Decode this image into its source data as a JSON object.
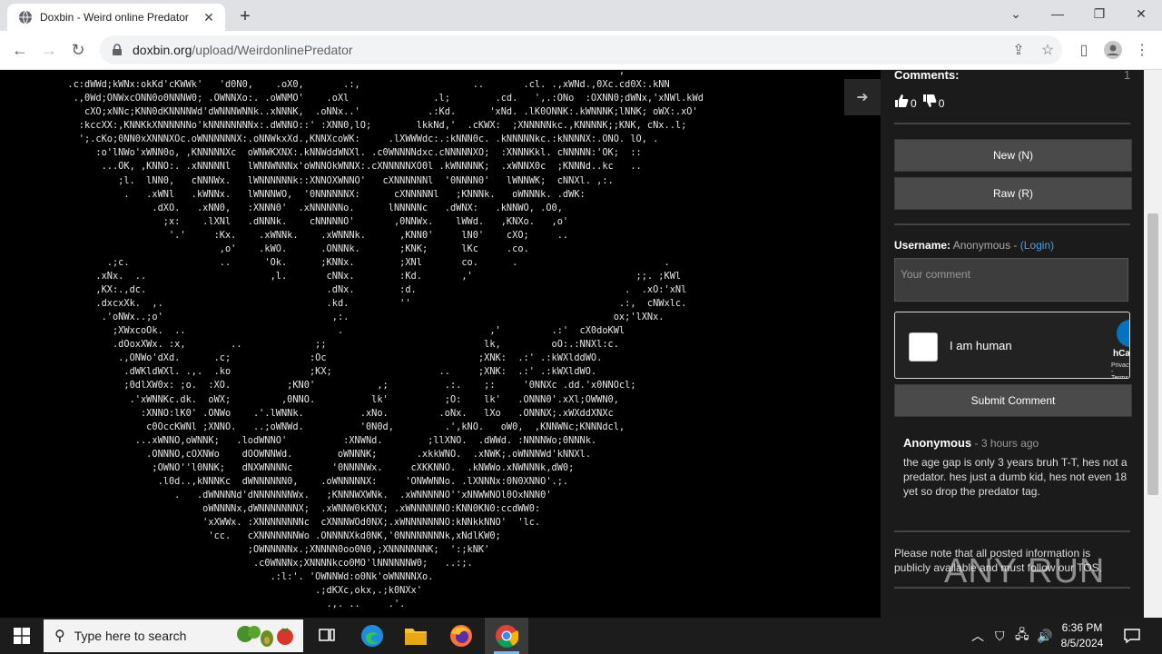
{
  "browser": {
    "tab_title": "Doxbin - Weird online Predator",
    "url_host": "doxbin.org",
    "url_path": "/upload/WeirdonlinePredator"
  },
  "ascii_art": "                                                                                                              ,\n            .c:dWWd;kWNx:okKd'cKWWk'   'd0N0,    .oX0,       .:,                    ..       .cl. .,xWNd.,0Xc.cd0X:.kNN\n             .,0Wd;ONWxcONN0o0NNNW0; .OWNNXo:. .oWNMO'    .oXl               .l;        .cd.   ',.:ONo  :OXNN0;dWNx,'xNWl.kWd\n               cXO;xNNc;KNN0dKNNNNWd'dWNNNWNNk..xNNNK,  .oNNx..'            .:Kd.      'xNd. .lK0ONNK:.kWNNNK;lNNK; oWX:.xO'\n              :kccXX:,KNNKkXNNNNNNo'kNNNNNNNNx:.dWNNO::' :XNN0,lO;        lkkNd,'  .cKWX:  ;XNNNNNkc.,KNNNNK;;KNK, cNx..l;\n              ';.cKo;0NN0xXNNNXOc.oWNNNNNNX:.oNNWkxXd.,KNNXcoWK:     .lXWWWdc:.:kNNN0c. .kNNNNNkc.:kNNNNX:.ONO. lO, .\n                 :o'lNWo'xWNN0o, ,KNNNNNXc  oWNWKXNX:.kNNWddWNXl. .c0WNNNNdxc.cNNNNNXO;  :XNNNKkl. cNNNNN:'OK;  ::\n                  ...OK, ,KNNO:. .xNNNNNl   lWNNWNNNx'oWNNOkWNNX:.cXNNNNNXO0l .kWNNNNK;  .xWNNX0c  ;KNNNd..kc   ..\n                     ;l.  lNN0,   cNNNWx.   lWNNNNNNk::XNNOXWNNO'   cXNNNNNNl  '0NNNN0'   lWNNWK;  cNNXl. ,:.\n                      .   .xWNl   .kWNNx.   lWNNNWO,  '0NNNNNNX:      cXNNNNNl   ;KNNNk.   oWNNNk. .dWK:\n                           .dXO.   .xNN0,   :XNNN0'  .xNNNNNNo.      lNNNNNc   .dWNX:   .kNNWO, .O0,\n                             ;x:    .lXNl   .dNNNk.    cNNNNNO'       ,0NNWx.    lWWd.   ,KNXo.   ,o'\n                              '.'     :Kx.    .xWNNk.    .xWNNNk.      ,KNN0'     lN0'    cXO;     ..\n                                       ,o'    .kWO.      .ONNNk.       ;KNK;      lKc     .co.\n                   .;c.                ..      'Ok.      ;KNNx.        ;XNl       co.      .                          .\n                 .xNx.  ..                      ,l.       cNNx.        :Kd.       ,'                             ;;. ;KWl\n                 ,KX:.,dc.                                .dNx.        :d.                                     .  .xO:'xNl\n                 .dxcxXk.  ,.                             .kd.         ''                                     .:,  cNWxlc.\n                  .'oNWx..;o'                              ,:.                                               ox;'lXNx.\n                    ;XWxcoOk.  ..                           .                          ,'         .:'  cX0doKWl\n                    .dOoxXWx. :x,        ..             ;;                            lk,         oO:.:NNXl:c.\n                     .,ONWo'dXd.      .c;              :Oc                           ;XNK:  .:' .:kWXlddWO.\n                      .dWKldWXl. .,.  .ko              ;KX;                   ..     ;XNK:  .:' .:kWXldWO.\n                      ;0dlXW0x: ;o.  :XO.          ;KN0'           ,;          .:.    ;:     '0NNXc .dd.'x0NNOcl;\n                       .'xWNNKc.dk.  oWX;         ,0NNO.          lk'          ;O:    lk'   .ONNN0'.xXl;OWWN0,\n                         :XNNO:lK0' .ONWo    .'.lWNNk.          .xNo.         .oNx.   lXo   .ONNNX;.xWXddXNXc\n                          c0OccKWNl ;XNNO.   ..;oWNWd.          '0N0d,         .',kNO.   oW0,  ,KNNWNc;KNNNdcl,\n                        ...xWNNO,oWNNK;   .lodWNNO'          :XNWNd.        ;llXNO.  .dWWd. :NNNNWo;0NNNk.\n                          .ONNNO,cOXNWo    dOOWNNWd.        oWNNNK;       .xkkWNO.  .xNWK;.oWNNNWd'kNNXl.\n                           ;OWNO''l0NNK;   dNXWNNNNc       '0NNNNWx.     cXKKNNO.  .kNWWo.xNWNNNk,dW0;\n                            .l0d..,kNNNKc  dWNNNNNN0,    .oWNNNNNX:     'ONWWNNo. .lXNNNx:0N0XNNO'.;.\n                               .   .dWNNNNd'dNNNNNNNWx.   ;KNNNWXWNk.  .xWNNNNNO''xNNWWNOl0OxNNN0'\n                                    oWNNNNx,dWNNNNNNNX;  .xWNNW0kKNX; .xWNNNNNNO:KNN0KN0:ccdWW0:\n                                    'xXWWx. :XNNNNNNNNc  cXNNNWOd0NX;.xWNNNNNNNO:kNNkkNNO'  'lc.\n                                     'cc.   cXNNNNNNNWo .ONNNNXkd0NK,'0NNNNNNNNk,xNdlKW0;\n                                            ;OWNNNNNx.;XNNNN0oo0N0,;XNNNNNNNK;  ':;kNK'\n                                             .c0WNNNx;XNNNNkco0MO'lNNNNNNW0;   ..:;.\n                                                .:l:'. 'OWNNWd:o0Nk'oWNNNNXo.\n                                                        .;dKXc,okx,.;k0NXx'\n                                                          .,. ..     .'.",
  "sidebar": {
    "comments_heading": "Comments:",
    "comments_count": "1",
    "upvotes": "0",
    "downvotes": "0",
    "new_button": "New (N)",
    "raw_button": "Raw (R)",
    "username_label": "Username:",
    "username_value": "Anonymous",
    "login_link": "(Login)",
    "comment_placeholder": "Your comment",
    "captcha_label": "I am human",
    "captcha_brand": "hCaptcha",
    "captcha_privacy": "Privacy - Terms",
    "submit_button": "Submit Comment",
    "comment": {
      "author": "Anonymous",
      "time": "3 hours ago",
      "body": "the age gap is only 3 years bruh T-T, hes not a predator. hes just a dumb kid, hes not even 18 yet so drop the predator tag."
    },
    "notice": "Please note that all posted information is publicly available and must follow our TOS."
  },
  "watermark": "ANY RUN",
  "taskbar": {
    "search_placeholder": "Type here to search",
    "time": "6:36 PM",
    "date": "8/5/2024"
  }
}
